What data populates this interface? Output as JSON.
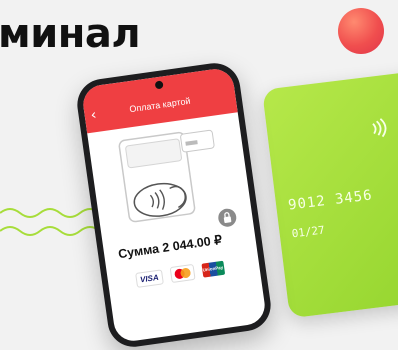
{
  "hero": {
    "title": "минал"
  },
  "phone": {
    "header_title": "Оплата картой",
    "back_icon": "chevron-left-icon",
    "amount": "Сумма 2 044.00 ₽",
    "lock_icon": "lock-icon",
    "payment_logos": [
      "VISA",
      "mastercard",
      "UnionPay"
    ]
  },
  "card": {
    "number": "9012 3456",
    "expiry": "01/27",
    "contactless_icon": "contactless-icon"
  },
  "colors": {
    "accent_red": "#ef3f42",
    "card_green": "#9edc35",
    "ball_orange": "#f05a4e"
  }
}
